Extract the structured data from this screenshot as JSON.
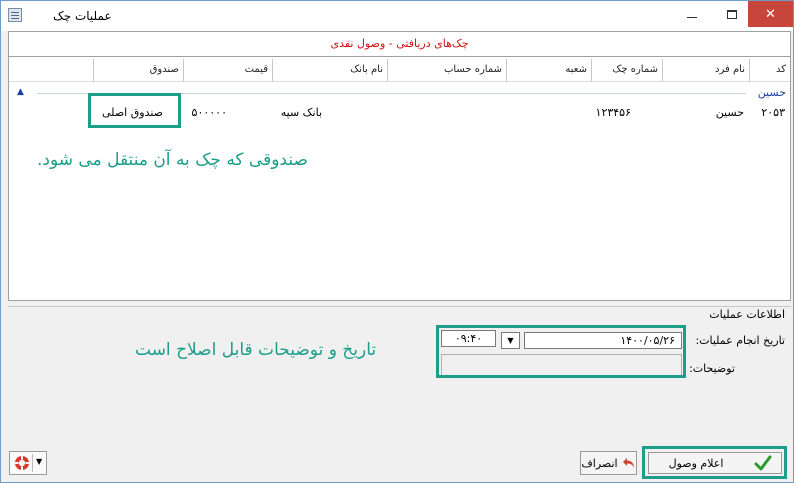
{
  "window": {
    "title": "عملیات چک",
    "minimize_icon": "minimize-icon",
    "maximize_icon": "maximize-icon",
    "close_icon": "close-icon",
    "close_glyph": "✕"
  },
  "grid": {
    "caption": "چک‌های دریافتی - وصول نقدی",
    "columns": [
      "کد",
      "نام فرد",
      "شماره چک",
      "شعبه",
      "شماره حساب",
      "نام بانک",
      "قیمت",
      "صندوق"
    ],
    "group_label": "حسین",
    "rows": [
      {
        "code": "۲۰۵۳",
        "person": "حسین",
        "check_number": "۱۲۳۴۵۶",
        "branch": "",
        "account": "",
        "bank": "بانک سپه",
        "price": "۵۰۰۰۰۰",
        "fund": "صندوق اصلی"
      }
    ]
  },
  "annotations": {
    "fund_note": "صندوقی که چک به آن منتقل می شود.",
    "date_note": "تاریخ و توضیحات قابل اصلاح است"
  },
  "info": {
    "legend": "اطلاعات عملیات",
    "date_label": "تاریخ انجام عملیات:",
    "date_value": "۱۴۰۰/۰۵/۲۶",
    "time_value": "۰۹:۴۰",
    "desc_label": "توضیحات:"
  },
  "buttons": {
    "ok_label": "اعلام وصول",
    "cancel_label": "انصراف"
  },
  "colors": {
    "highlight": "#1e9e88",
    "caption": "#d01010",
    "group": "#1a3ea8",
    "close": "#c7453a"
  }
}
